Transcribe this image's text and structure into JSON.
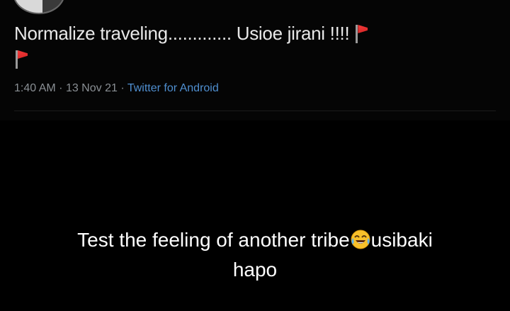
{
  "tweet": {
    "text": "Normalize traveling............. Usioe jirani !!!!",
    "flag_icon": "red-flag-icon",
    "time": "1:40 AM",
    "separator": "·",
    "date": "13 Nov 21",
    "source": "Twitter for Android"
  },
  "caption": {
    "line1_before": "Test the feeling of another tribe",
    "emoji_icon": "tears-of-joy-emoji",
    "line1_after": "usibaki",
    "line2": "hapo"
  },
  "colors": {
    "background": "#000000",
    "text": "#e8e8e8",
    "meta": "#8a8f94",
    "source_link": "#4f8fd0",
    "flag": "#e03030"
  }
}
